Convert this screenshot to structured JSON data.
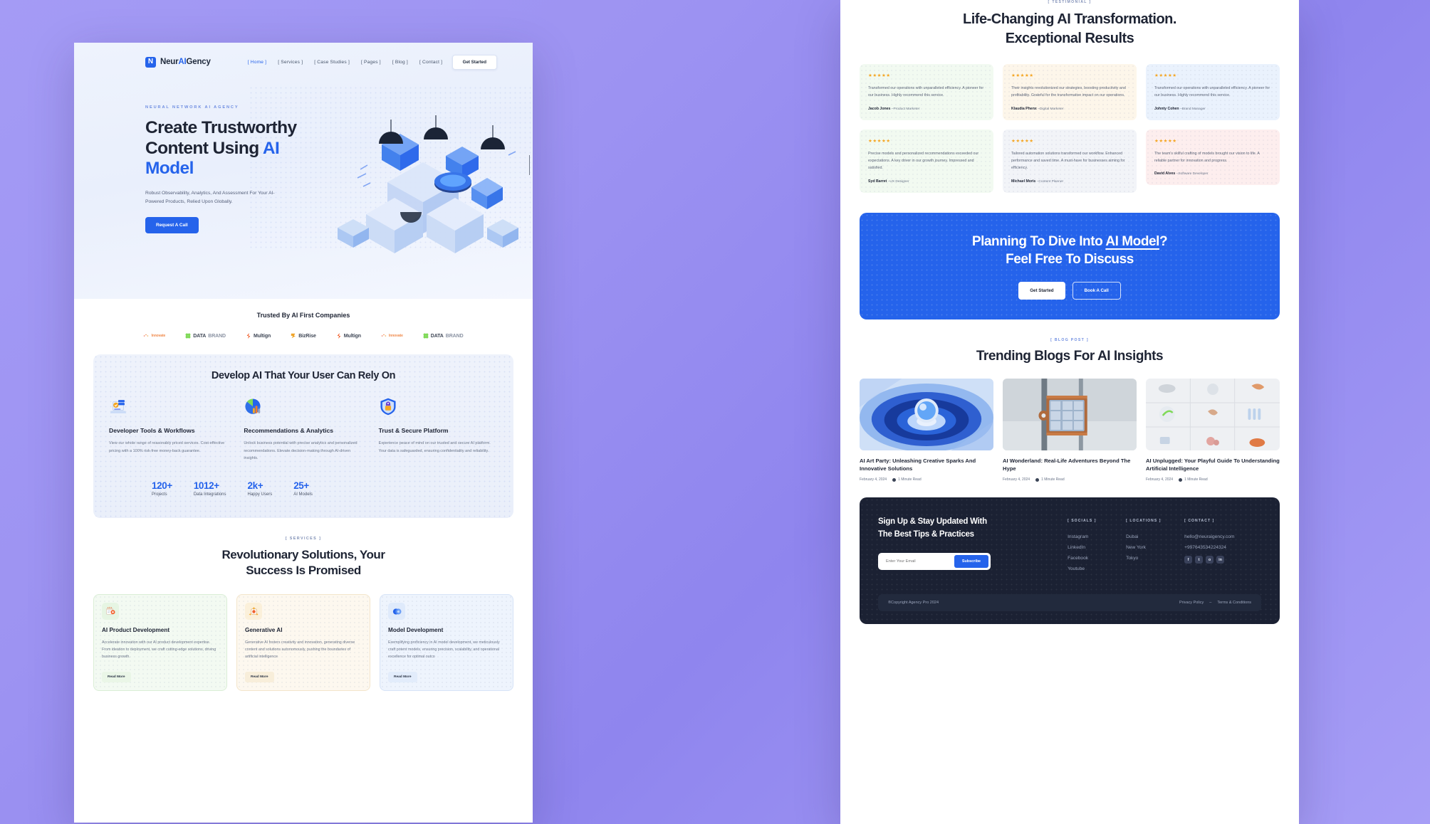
{
  "brand": {
    "mark": "N",
    "name_part1": "Neur",
    "name_accent": "AI",
    "name_part2": "Gency"
  },
  "nav": {
    "items": [
      {
        "label": "[ Home ]",
        "active": true
      },
      {
        "label": "[ Services ]",
        "active": false
      },
      {
        "label": "[ Case Studies ]",
        "active": false
      },
      {
        "label": "[ Pages ]",
        "active": false
      },
      {
        "label": "[ Blog ]",
        "active": false
      },
      {
        "label": "[ Contact ]",
        "active": false
      }
    ],
    "cta_label": "Get Started"
  },
  "hero": {
    "eyebrow": "NEURAL NETWORK AI AGENCY",
    "title_line1": "Create Trustworthy",
    "title_line2_plain": "Content Using ",
    "title_line2_accent": "AI Model",
    "subtitle": "Robust Observability, Analytics, And Assessment For Your AI-Powered Products, Relied Upon Globally.",
    "button_label": "Request A Call"
  },
  "trusted": {
    "heading": "Trusted By AI First Companies",
    "logos": [
      {
        "name": "Innovate",
        "light": ""
      },
      {
        "name": "DATA",
        "light": "BRAND"
      },
      {
        "name": "Multign",
        "light": ""
      },
      {
        "name": "BizRise",
        "light": ""
      },
      {
        "name": "Multign",
        "light": ""
      },
      {
        "name": "Innovate",
        "light": ""
      },
      {
        "name": "DATA",
        "light": "BRAND"
      }
    ]
  },
  "develop": {
    "heading": "Develop AI That Your User Can Rely On",
    "features": [
      {
        "icon": "laptop-dashboard-icon",
        "title": "Developer Tools & Workflows",
        "desc": "View our whole range of reasonably priced services. Cost-effective pricing with a 100% risk-free money-back guarantee."
      },
      {
        "icon": "pie-chart-icon",
        "title": "Recommendations & Analytics",
        "desc": "Unlock business potential with precise analytics and personalized recommendations. Elevate decision-making through AI-driven insights."
      },
      {
        "icon": "shield-lock-icon",
        "title": "Trust & Secure Platform",
        "desc": "Experience peace of mind on our trusted and secure AI platform. Your data is safeguarded, ensuring confidentiality and reliability."
      }
    ],
    "stats": [
      {
        "num": "120+",
        "label": "Projects"
      },
      {
        "num": "1012+",
        "label": "Data Integrations"
      },
      {
        "num": "2k+",
        "label": "Happy Users"
      },
      {
        "num": "25+",
        "label": "AI Models"
      }
    ]
  },
  "services": {
    "tag": "[ SERVICES ]",
    "heading_line1": "Revolutionary Solutions, Your",
    "heading_line2": "Success Is Promised",
    "cards": [
      {
        "icon": "browser-gear-icon",
        "title": "AI Product Development",
        "desc": "Accelerate innovation with our AI product development expertise. From ideation to deployment, we craft cutting-edge solutions, driving business growth.",
        "button": "Read More"
      },
      {
        "icon": "sparkle-chip-icon",
        "title": "Generative AI",
        "desc": "Generative AI fosters creativity and innovation, generating diverse content and solutions autonomously, pushing the boundaries of artificial intelligence",
        "button": "Read More"
      },
      {
        "icon": "overlap-circles-icon",
        "title": "Model Development",
        "desc": "Exemplifying proficiency in AI model development, we meticulously craft potent models, ensuring precision, scalability, and operational excellence for optimal outco",
        "button": "Read More"
      }
    ]
  },
  "testimonials": {
    "tag": "[ TESTIMONIAL ]",
    "heading_line1": "Life-Changing AI Transformation.",
    "heading_line2": "Exceptional Results",
    "stars": "★★★★★",
    "items": [
      {
        "tone": "g",
        "quote": "Transformed our operations with unparalleled efficiency. A pioneer for our business. Highly recommend this service.",
        "name": "Jacob Jones",
        "role": "–Product Marketer"
      },
      {
        "tone": "y",
        "quote": "Their insights revolutionized our strategies, boosting productivity and profitability. Grateful for the transformative impact on our operations.",
        "name": "Klaudia Phenx",
        "role": "–Digital Marketer"
      },
      {
        "tone": "b",
        "quote": "Transformed our operations with unparalleled efficiency. A pioneer for our business. Highly recommend this service.",
        "name": "Johnty Cohen",
        "role": "–Brand Manager"
      },
      {
        "tone": "g",
        "quote": "Precise models and personalized recommendations exceeded our expectations. A key driver in our growth journey. Impressed and satisfied.",
        "name": "Syd Barret",
        "role": "–UX Designer"
      },
      {
        "tone": "s",
        "quote": "Tailored automation solutions transformed our workflow. Enhanced performance and saved time. A must-have for businesses aiming for efficiency.",
        "name": "Michael Moris",
        "role": "–Content Planner"
      },
      {
        "tone": "p",
        "quote": "The team's skilful crafting of models brought our vision to life. A reliable partner for innovation and progress.",
        "name": "David Alves",
        "role": "–Software Developer"
      }
    ]
  },
  "cta": {
    "line1_before": "Planning To Dive Into ",
    "line1_underline": "AI Model",
    "line1_after": "?",
    "line2": "Feel Free To Discuss",
    "primary_label": "Get Started",
    "secondary_label": "Book A Call"
  },
  "blogs": {
    "tag": "[ BLOG POST ]",
    "heading": "Trending Blogs For AI Insights",
    "posts": [
      {
        "image": "blue-vortex-sphere-image",
        "title": "AI Art Party: Unleashing Creative Sparks And Innovative Solutions",
        "date": "February 4, 2024",
        "read": "1 Minute Read"
      },
      {
        "image": "copper-server-module-image",
        "title": "AI Wonderland: Real-Life Adventures Beyond The Hype",
        "date": "February 4, 2024",
        "read": "1 Minute Read"
      },
      {
        "image": "object-grid-image",
        "title": "AI Unplugged: Your Playful Guide To Understanding Artificial Intelligence",
        "date": "February 4, 2024",
        "read": "1 Minute Read"
      }
    ]
  },
  "footer": {
    "signup_line1": "Sign Up & Stay Updated With",
    "signup_line2": "The Best Tips & Practices",
    "email_placeholder": "Enter Your Email",
    "email_value": "",
    "subscribe_label": "Subscribe",
    "socials_heading": "[ SOCIALS ]",
    "socials": [
      "Instagram",
      "LinkedIn",
      "Facebook",
      "Youtube"
    ],
    "locations_heading": "[ LOCATIONS ]",
    "locations": [
      "Dubai",
      "New York",
      "Tokyo"
    ],
    "contact_heading": "[ CONTACT ]",
    "email": "hello@neuraigency.com",
    "phone": "+997643534224324",
    "social_icons": [
      "f",
      "t",
      "o",
      "in"
    ],
    "copyright": "®Copyright Agency Pro 2024",
    "privacy": "Privacy Policy",
    "sep": "–",
    "terms": "Terms & Conditions"
  },
  "colors": {
    "accent": "#2563eb",
    "dark": "#1e2434",
    "footer_bg": "#1b2133",
    "star": "#f5a623"
  }
}
